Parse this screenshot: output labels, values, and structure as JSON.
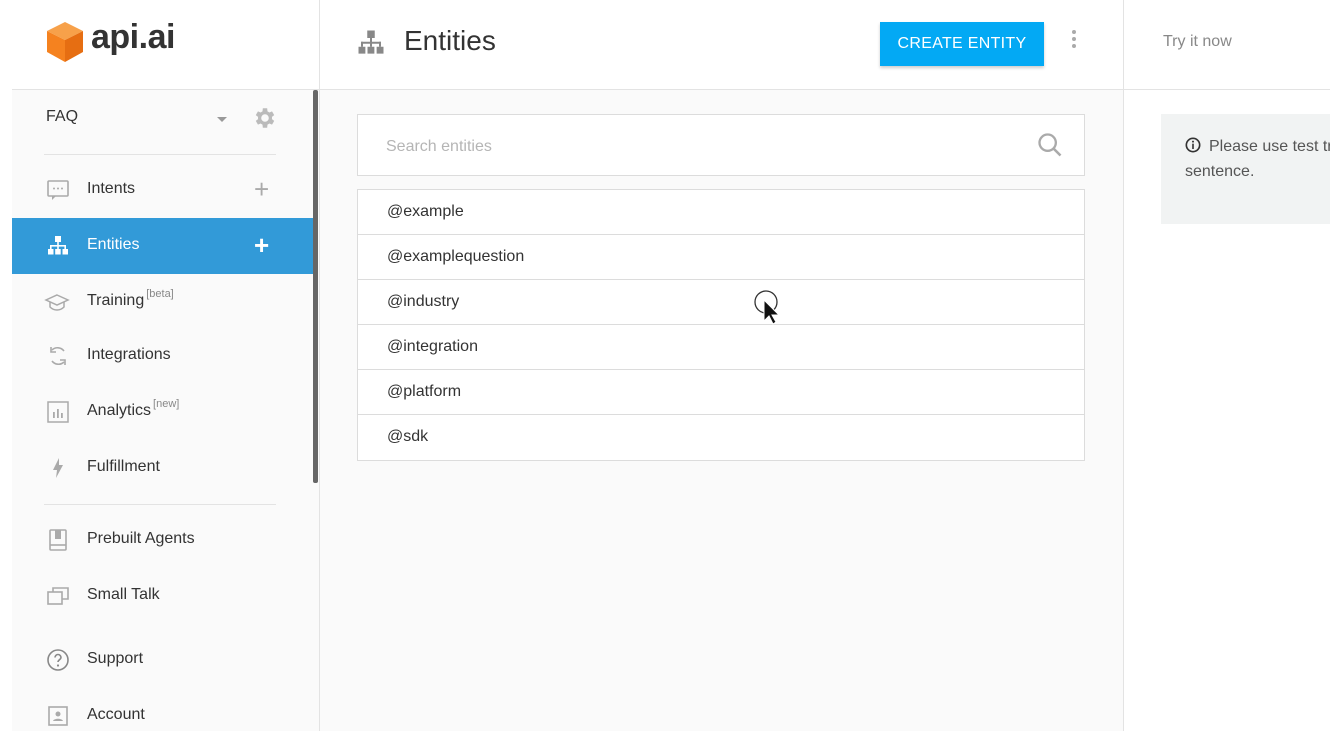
{
  "app": {
    "logo_text": "api.ai"
  },
  "sidebar": {
    "agent_name": "FAQ",
    "items": [
      {
        "label": "Intents",
        "tag": "",
        "icon": "chat-icon",
        "has_add": true
      },
      {
        "label": "Entities",
        "tag": "",
        "icon": "sitemap-icon",
        "has_add": true,
        "active": true
      },
      {
        "label": "Training",
        "tag": "[beta]",
        "icon": "graduation-cap-icon"
      },
      {
        "label": "Integrations",
        "tag": "",
        "icon": "sync-icon"
      },
      {
        "label": "Analytics",
        "tag": "[new]",
        "icon": "bar-chart-icon"
      },
      {
        "label": "Fulfillment",
        "tag": "",
        "icon": "bolt-icon"
      },
      {
        "label": "Prebuilt Agents",
        "tag": "",
        "icon": "book-icon"
      },
      {
        "label": "Small Talk",
        "tag": "",
        "icon": "windows-icon"
      },
      {
        "label": "Support",
        "tag": "",
        "icon": "help-icon"
      },
      {
        "label": "Account",
        "tag": "",
        "icon": "account-icon"
      }
    ]
  },
  "main": {
    "title": "Entities",
    "create_button": "CREATE ENTITY",
    "search_placeholder": "Search entities",
    "entities": [
      "@example",
      "@examplequestion",
      "@industry",
      "@integration",
      "@platform",
      "@sdk"
    ]
  },
  "right_panel": {
    "try_label": "Try it now",
    "info_text": "Please use test try a sentence."
  },
  "colors": {
    "accent": "#329ad8",
    "button": "#03a9f4",
    "logo": "#f5821f"
  }
}
